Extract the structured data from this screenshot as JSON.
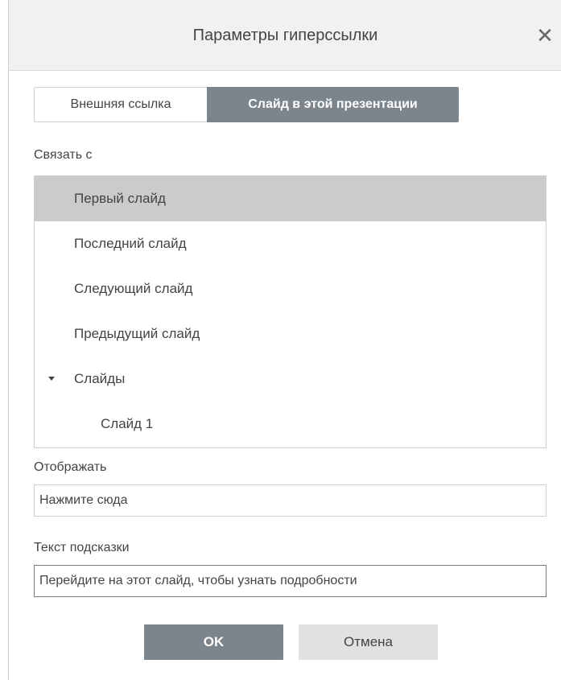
{
  "dialog": {
    "title": "Параметры гиперссылки",
    "close_icon": "close-icon"
  },
  "tabs": [
    {
      "label": "Внешняя ссылка",
      "active": false
    },
    {
      "label": "Слайд в этой презентации",
      "active": true
    }
  ],
  "link_to": {
    "label": "Связать с",
    "items": [
      {
        "label": "Первый слайд",
        "selected": true
      },
      {
        "label": "Последний слайд",
        "selected": false
      },
      {
        "label": "Следующий слайд",
        "selected": false
      },
      {
        "label": "Предыдущий слайд",
        "selected": false
      },
      {
        "label": "Слайды",
        "expanded": true,
        "icon": "caret-down-icon"
      },
      {
        "label": "Слайд 1",
        "child": true
      }
    ]
  },
  "display": {
    "label": "Отображать",
    "value": "Нажмите сюда"
  },
  "tooltip": {
    "label": "Текст подсказки",
    "value": "Перейдите на этот слайд, чтобы узнать подробности"
  },
  "buttons": {
    "ok_label": "OK",
    "cancel_label": "Отмена"
  },
  "colors": {
    "accent": "#7d858c",
    "selected_row": "#cbcbcb",
    "titlebar": "#f1f1f1"
  }
}
